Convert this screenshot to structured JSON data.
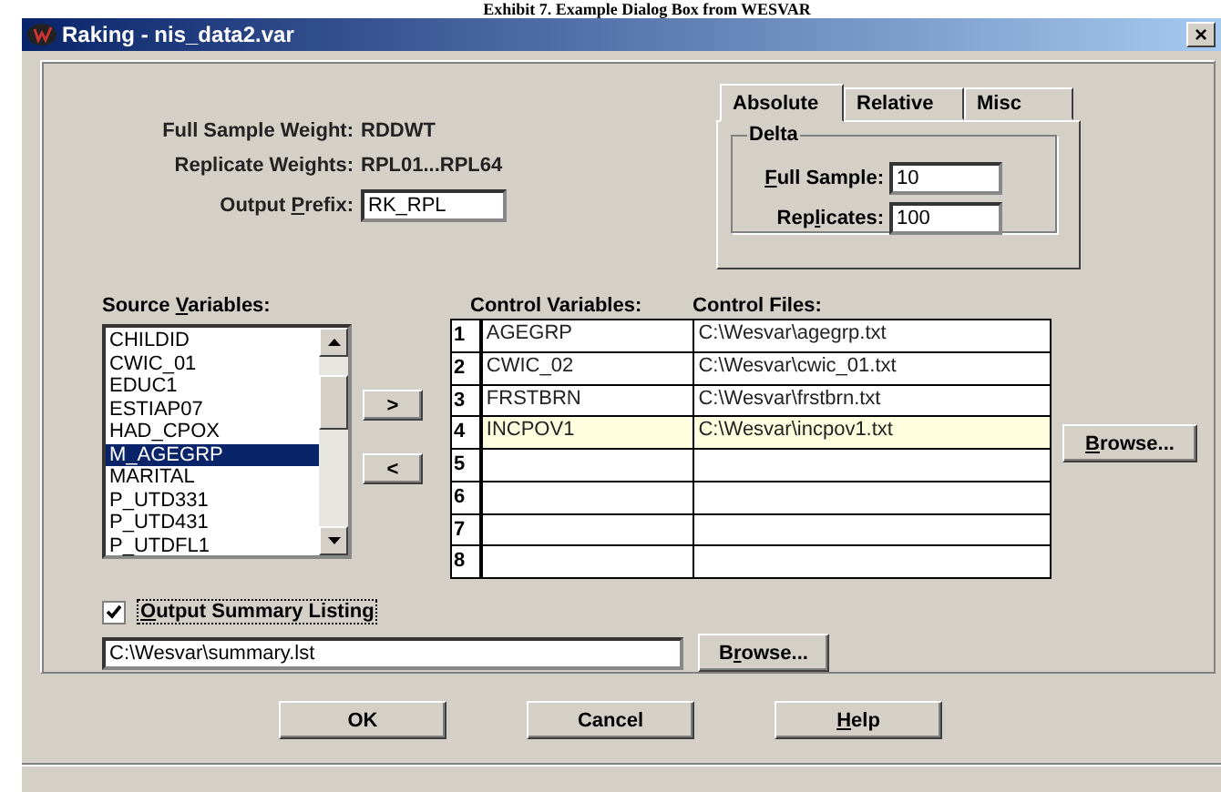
{
  "caption": "Exhibit 7. Example Dialog Box from WESVAR",
  "window": {
    "title": "Raking - nis_data2.var",
    "close": "×"
  },
  "weights": [
    {
      "label": "Full Sample Weight:",
      "value": "RDDWT"
    },
    {
      "label": "Replicate Weights:",
      "value": "RPL01...RPL64"
    }
  ],
  "output_prefix": {
    "label": {
      "start": "Output ",
      "key": "P",
      "end": "refix:"
    },
    "value": "RK_RPL"
  },
  "tabs": [
    {
      "label": "Absolute",
      "selected": true
    },
    {
      "label": "Relative",
      "selected": false
    },
    {
      "label": "Misc",
      "selected": false
    }
  ],
  "delta": {
    "title": "Delta",
    "fields": [
      {
        "label": {
          "key": "F",
          "end": "ull Sample:"
        },
        "value": "10"
      },
      {
        "label": {
          "start": "Rep",
          "key": "l",
          "end": "icates:"
        },
        "value": "100"
      }
    ]
  },
  "source_variables": {
    "label": {
      "start": "Source ",
      "key": "V",
      "end": "ariables:"
    },
    "items": [
      {
        "text": "CHILDID",
        "selected": false
      },
      {
        "text": "CWIC_01",
        "selected": false
      },
      {
        "text": "EDUC1",
        "selected": false
      },
      {
        "text": "ESTIAP07",
        "selected": false
      },
      {
        "text": "HAD_CPOX",
        "selected": false
      },
      {
        "text": "M_AGEGRP",
        "selected": true
      },
      {
        "text": "MARITAL",
        "selected": false
      },
      {
        "text": "P_UTD331",
        "selected": false
      },
      {
        "text": "P_UTD431",
        "selected": false
      },
      {
        "text": "P_UTDFL1",
        "selected": false
      }
    ]
  },
  "move_buttons": [
    ">",
    "<"
  ],
  "control_table": {
    "columns": [
      "Control Variables:",
      "Control Files:"
    ],
    "rows": [
      {
        "number": "1",
        "variable": "AGEGRP",
        "file": "C:\\Wesvar\\agegrp.txt",
        "selected": false
      },
      {
        "number": "2",
        "variable": "CWIC_02",
        "file": "C:\\Wesvar\\cwic_01.txt",
        "selected": false
      },
      {
        "number": "3",
        "variable": "FRSTBRN",
        "file": "C:\\Wesvar\\frstbrn.txt",
        "selected": false
      },
      {
        "number": "4",
        "variable": "INCPOV1",
        "file": "C:\\Wesvar\\incpov1.txt",
        "selected": true
      },
      {
        "number": "5",
        "selected": false
      },
      {
        "number": "6",
        "selected": false
      },
      {
        "number": "7",
        "selected": false
      },
      {
        "number": "8",
        "selected": false
      }
    ],
    "browse": {
      "label": {
        "key": "B",
        "end": "rowse..."
      }
    }
  },
  "summary": {
    "label": {
      "key": "O",
      "end": "utput Summary Listing"
    },
    "checked": true,
    "value": "C:\\Wesvar\\summary.lst",
    "browse": {
      "label": {
        "start": "B",
        "key": "r",
        "end": "owse..."
      }
    }
  },
  "buttons": [
    {
      "label": {
        "start": "OK"
      }
    },
    {
      "label": {
        "start": "Cancel"
      }
    },
    {
      "label": {
        "key": "H",
        "end": "elp"
      }
    }
  ]
}
